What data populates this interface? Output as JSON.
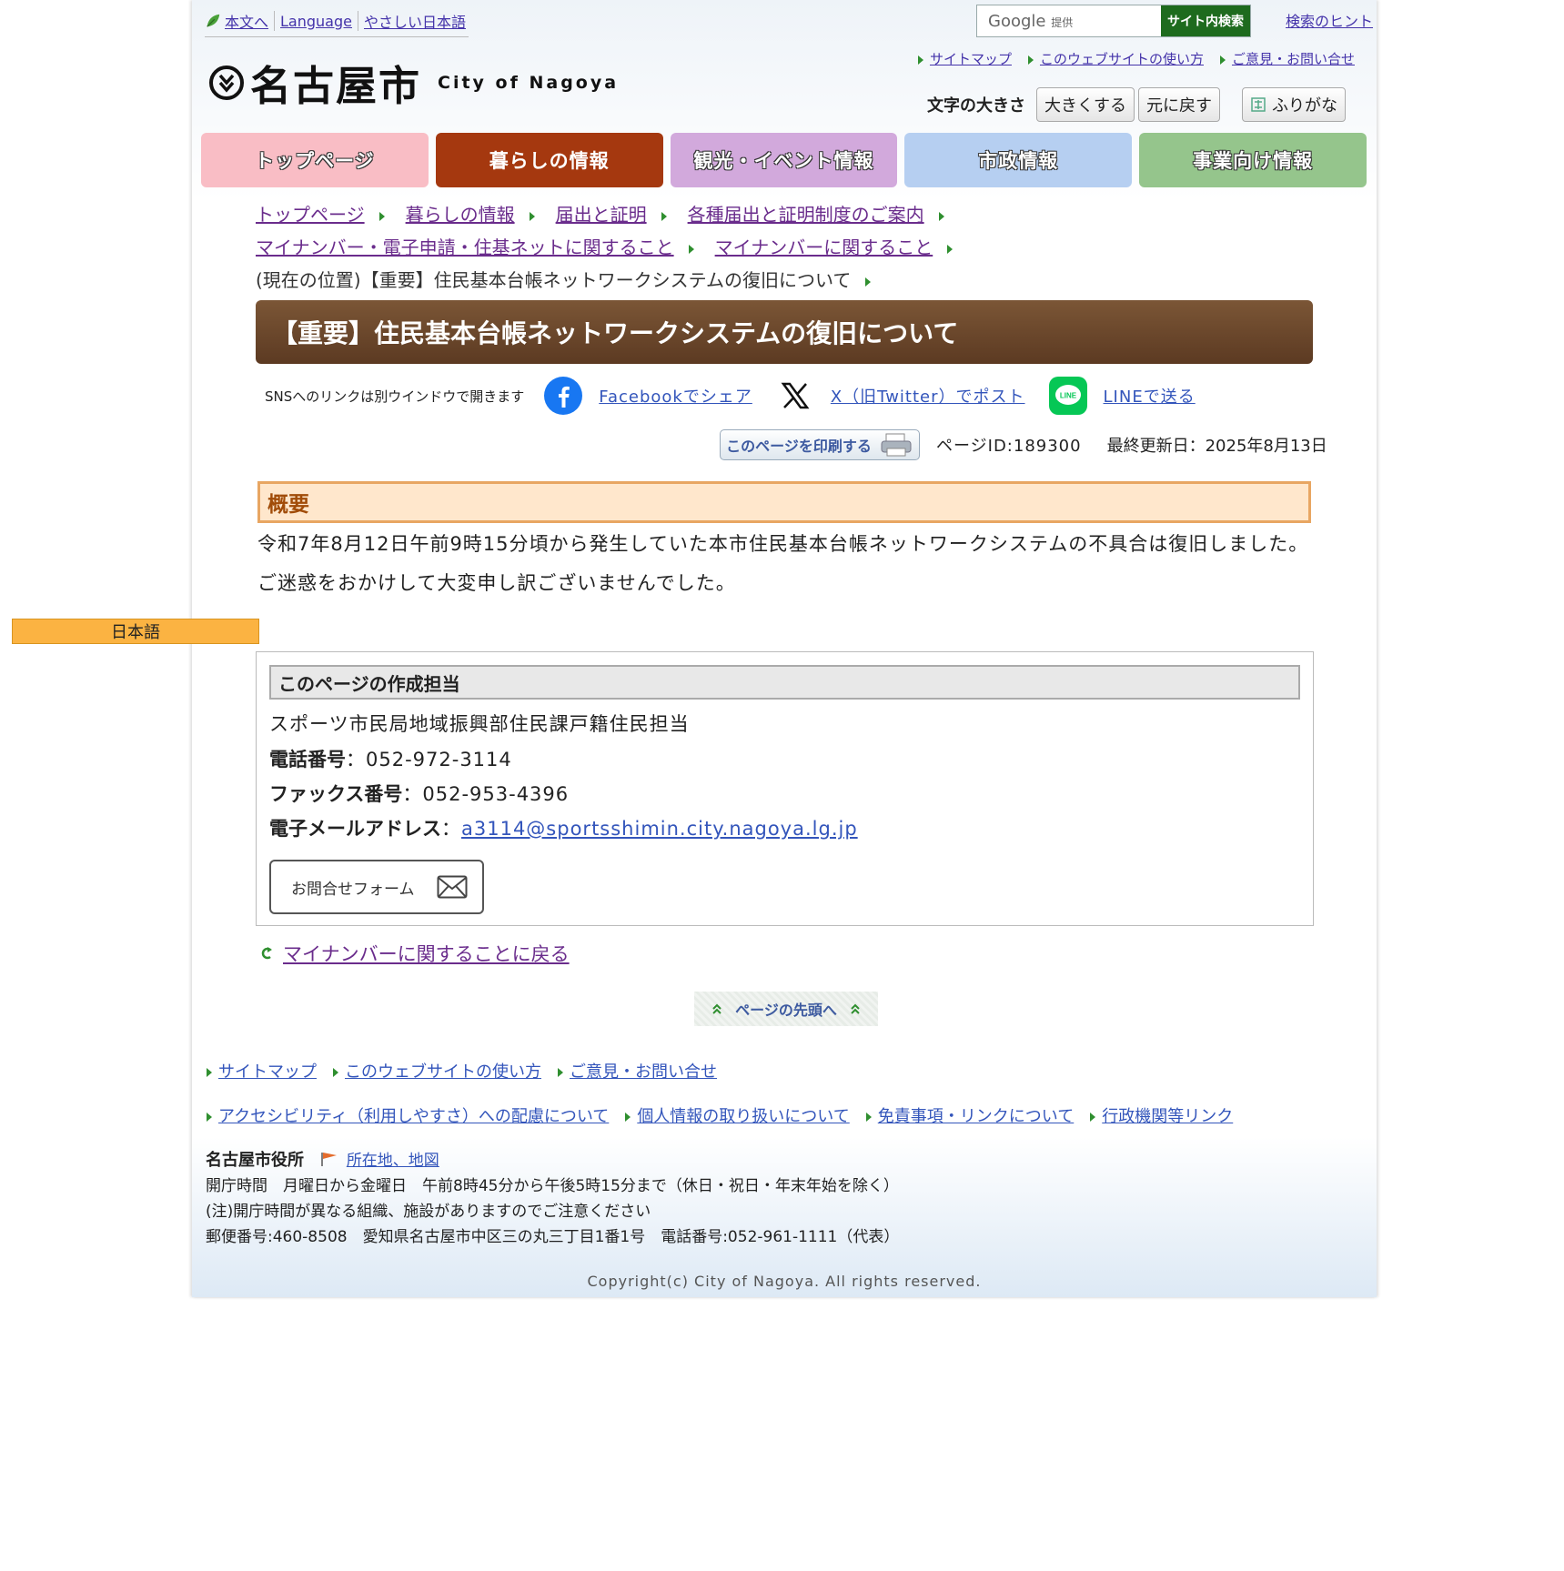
{
  "util_links": [
    "本文へ",
    "Language",
    "やさしい日本語"
  ],
  "logo": {
    "title": "名古屋市",
    "en": "City of Nagoya"
  },
  "search": {
    "placeholder_google": "Google",
    "placeholder_provided": "提供",
    "button": "サイト内検索",
    "hint": "検索のヒント"
  },
  "top_links": [
    "サイトマップ",
    "このウェブサイトの使い方",
    "ご意見・お問い合せ"
  ],
  "font_size": {
    "label": "文字の大きさ",
    "larger": "大きくする",
    "reset": "元に戻す",
    "furigana": "ふりがな"
  },
  "nav": [
    "トップページ",
    "暮らしの情報",
    "観光・イベント情報",
    "市政情報",
    "事業向け情報"
  ],
  "breadcrumb": {
    "items": [
      "トップページ",
      "暮らしの情報",
      "届出と証明",
      "各種届出と証明制度のご案内",
      "マイナンバー・電子申請・住基ネットに関すること",
      "マイナンバーに関すること"
    ],
    "current": "(現在の位置)【重要】住民基本台帳ネットワークシステムの復旧について"
  },
  "title": "【重要】住民基本台帳ネットワークシステムの復旧について",
  "sns": {
    "note": "SNSへのリンクは別ウインドウで開きます",
    "facebook": "Facebookでシェア",
    "x": "X（旧Twitter）でポスト",
    "line": "LINEで送る",
    "line_badge": "LINE"
  },
  "meta": {
    "print": "このページを印刷する",
    "page_id": "ページID:189300",
    "updated": "最終更新日：2025年8月13日"
  },
  "summary": {
    "heading": "概要",
    "line1": "令和7年8月12日午前9時15分頃から発生していた本市住民基本台帳ネットワークシステムの不具合は復旧しました。",
    "line2": "ご迷惑をおかけして大変申し訳ございませんでした。"
  },
  "lang_tab": "日本語",
  "contact": {
    "heading": "このページの作成担当",
    "dept": "スポーツ市民局地域振興部住民課戸籍住民担当",
    "tel_label": "電話番号",
    "tel": "：052-972-3114",
    "fax_label": "ファックス番号",
    "fax": "：052-953-4396",
    "email_label": "電子メールアドレス",
    "email_sep": "：",
    "email": "a3114@sportsshimin.city.nagoya.lg.jp",
    "form": "お問合せフォーム"
  },
  "back_link": "マイナンバーに関することに戻る",
  "page_top": "ページの先頭へ",
  "footer_links_1": [
    "サイトマップ",
    "このウェブサイトの使い方",
    "ご意見・お問い合せ"
  ],
  "footer_links_2": [
    "アクセシビリティ（利用しやすさ）への配慮について",
    "個人情報の取り扱いについて",
    "免責事項・リンクについて",
    "行政機関等リンク"
  ],
  "office": {
    "name": "名古屋市役所",
    "map_link": "所在地、地図",
    "hours": "開庁時間　月曜日から金曜日　午前8時45分から午後5時15分まで（休日・祝日・年末年始を除く）",
    "note": "(注)開庁時間が異なる組織、施設がありますのでご注意ください",
    "address": "郵便番号:460-8508　愛知県名古屋市中区三の丸三丁目1番1号　電話番号:052-961-1111（代表）"
  },
  "copyright": "Copyright(c) City of Nagoya. All rights reserved.",
  "colors": {
    "accent_brown": "#5c3a22",
    "nav_life": "#a5380f",
    "search_green": "#1e6b1e",
    "summary_border": "#e8a662"
  }
}
